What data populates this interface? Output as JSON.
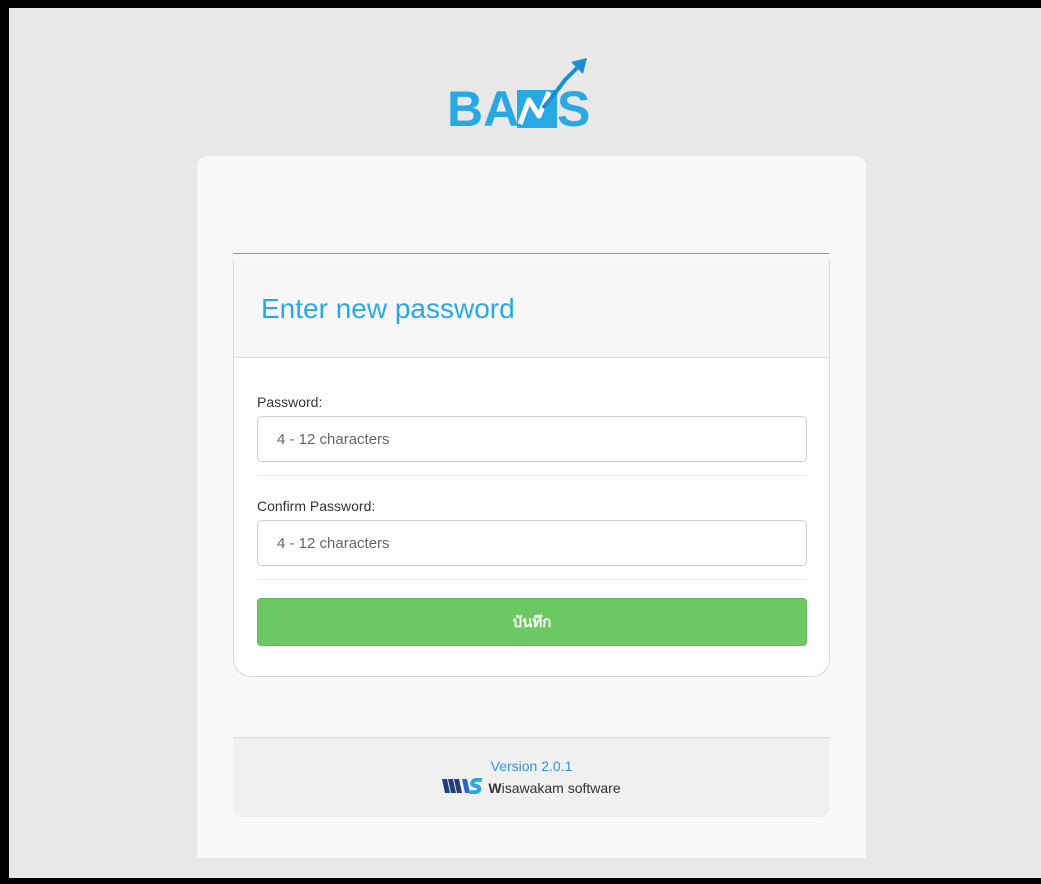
{
  "logo": {
    "text": "BAMS"
  },
  "panel": {
    "title": "Enter new password"
  },
  "form": {
    "password": {
      "label": "Password:",
      "placeholder": "4 - 12 characters",
      "value": ""
    },
    "confirm_password": {
      "label": "Confirm Password:",
      "placeholder": "4 - 12 characters",
      "value": ""
    },
    "save_label": "บันทึก"
  },
  "footer": {
    "version": "Version 2.0.1",
    "company_initial": "W",
    "company_rest": "isawakam software"
  },
  "colors": {
    "brand_blue": "#29a9e4",
    "save_green": "#6cc862",
    "version_blue": "#3a8fd6"
  }
}
